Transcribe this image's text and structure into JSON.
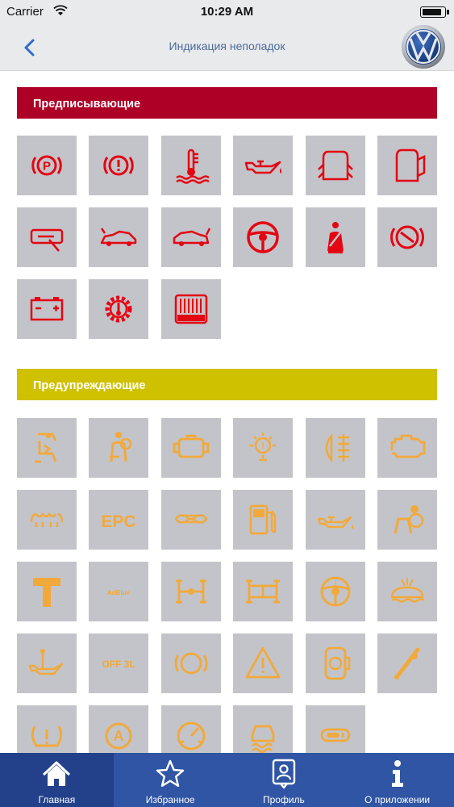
{
  "status_bar": {
    "carrier": "Carrier",
    "time": "10:29 AM"
  },
  "nav": {
    "title": "Индикация неполадок"
  },
  "sections": {
    "prescriptive": {
      "title": "Предписывающие",
      "color": "#ae0026",
      "icon_color": "#e30613",
      "icons": [
        "parking-brake-icon",
        "brake-warning-icon",
        "coolant-temperature-icon",
        "oil-pressure-icon",
        "door-open-icon",
        "door-open-alt-icon",
        "steering-lock-icon",
        "hood-open-icon",
        "trunk-open-icon",
        "steering-wheel-icon",
        "seatbelt-icon",
        "electric-parking-brake-icon",
        "battery-icon",
        "transmission-temperature-icon",
        "radiator-icon"
      ]
    },
    "warning": {
      "title": "Предупреждающие",
      "color": "#cfc100",
      "icon_color": "#f2a93b",
      "icons": [
        "child-seat-icon",
        "airbag-off-icon",
        "engine-check-alt-icon",
        "exterior-light-icon",
        "rear-fog-light-icon",
        "engine-check-icon",
        "glow-plug-icon",
        "epc-icon",
        "diesel-particulate-filter-icon",
        "fuel-level-icon",
        "oil-level-icon",
        "airbag-passenger-icon",
        "service-icon",
        "adblue-icon",
        "awd-differential-icon",
        "awd-lock-icon",
        "power-steering-icon",
        "washer-fluid-icon",
        "oil-sensor-icon",
        "off-road-icon",
        "parking-sensor-icon",
        "warning-triangle-icon",
        "fuel-cap-icon",
        "wiper-icon",
        "tire-pressure-icon",
        "start-stop-icon",
        "speedometer-icon",
        "traction-control-icon",
        "cruise-control-icon"
      ]
    }
  },
  "tabs": [
    {
      "label": "Главная",
      "icon": "home-icon",
      "active": true
    },
    {
      "label": "Избранное",
      "icon": "star-icon",
      "active": false
    },
    {
      "label": "Профиль",
      "icon": "profile-icon",
      "active": false
    },
    {
      "label": "О приложении",
      "icon": "info-icon",
      "active": false
    }
  ],
  "colors": {
    "bar_background": "#e9eaec",
    "title_color": "#4a6a9a",
    "tile_background": "#c2c4c9",
    "tabbar_background": "#2f55a4",
    "tab_active_background": "#22418a"
  }
}
